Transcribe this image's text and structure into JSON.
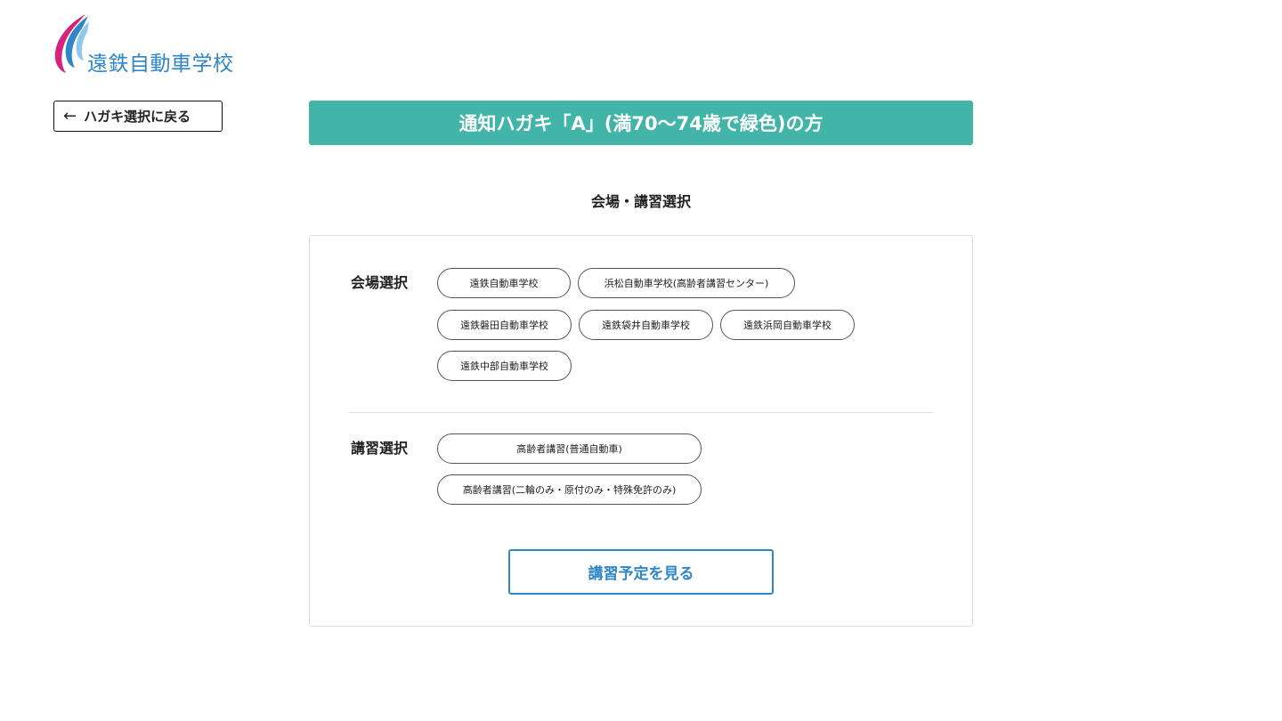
{
  "logo": {
    "text": "遠鉄自動車学校"
  },
  "back_button": {
    "arrow": "←",
    "label": "ハガキ選択に戻る"
  },
  "banner": {
    "title": "通知ハガキ「A」(満70〜74歳で緑色)の方"
  },
  "subtitle": "会場・講習選択",
  "venue": {
    "label": "会場選択",
    "options": [
      "遠鉄自動車学校",
      "浜松自動車学校(高齢者講習センター)",
      "遠鉄磐田自動車学校",
      "遠鉄袋井自動車学校",
      "遠鉄浜岡自動車学校",
      "遠鉄中部自動車学校"
    ]
  },
  "course": {
    "label": "講習選択",
    "options": [
      "高齢者講習(普通自動車)",
      "高齢者講習(二輪のみ・原付のみ・特殊免許のみ)"
    ]
  },
  "submit_button": {
    "label": "講習予定を見る"
  },
  "colors": {
    "brand_blue": "#2f86c9",
    "banner_teal": "#42b5a8",
    "logo_magenta": "#d6247e"
  }
}
